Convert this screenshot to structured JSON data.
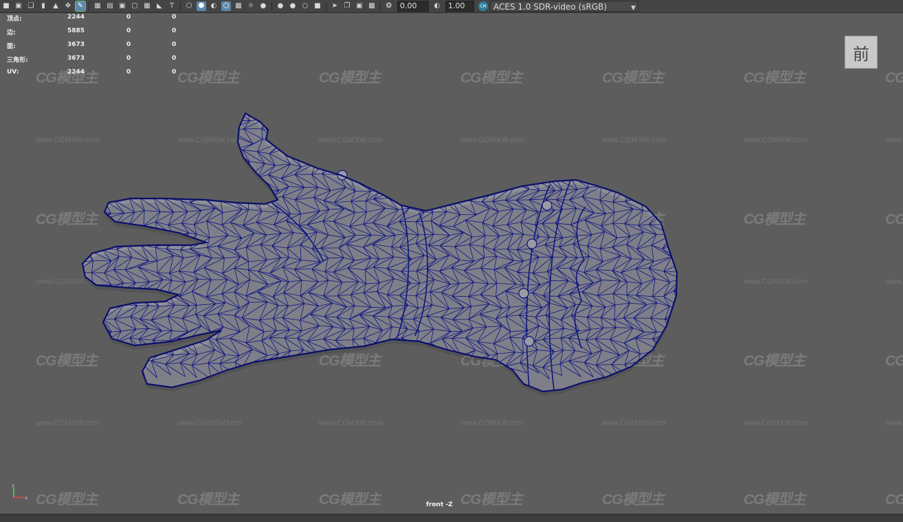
{
  "toolbar": {
    "icons": [
      "camera-icon",
      "camera-attributes-icon",
      "bookmark-icon",
      "image-plane-icon",
      "grid-icon",
      "2d-pan-icon",
      "grease-pencil-icon",
      "wireframe-icon",
      "resolution-gate-icon",
      "gate-mask-icon",
      "field-chart-icon",
      "safe-action-icon",
      "safe-title-icon",
      "shaded-icon",
      "smooth-shade-icon",
      "flat-shade-icon",
      "bounding-box-icon",
      "use-default-material-icon",
      "textured-icon",
      "lights-icon",
      "shadows-icon",
      "ambient-occlusion-icon",
      "motion-blur-icon",
      "anti-alias-icon",
      "depth-of-field-icon",
      "isolate-select-icon",
      "xray-icon",
      "xray-joints-icon",
      "xray-components-icon",
      "exposure-icon",
      "gamma-icon"
    ],
    "exposure_value": "0.00",
    "gamma_value": "1.00",
    "color_space_badge": "CM",
    "color_space": "ACES 1.0 SDR-video (sRGB)"
  },
  "hud": {
    "rows": [
      {
        "label": "顶点:",
        "v1": "2244",
        "v2": "0",
        "v3": "0"
      },
      {
        "label": "边:",
        "v1": "5885",
        "v2": "0",
        "v3": "0"
      },
      {
        "label": "面:",
        "v1": "3673",
        "v2": "0",
        "v3": "0"
      },
      {
        "label": "三角形:",
        "v1": "3673",
        "v2": "0",
        "v3": "0"
      },
      {
        "label": "UV:",
        "v1": "2244",
        "v2": "0",
        "v3": "0"
      }
    ]
  },
  "view_cube_label": "前",
  "camera_label": "front -Z",
  "axis": {
    "y": "y",
    "x": "x"
  },
  "watermark": {
    "logo": "CG模型主",
    "url": "www.CGMXW.com"
  },
  "colors": {
    "viewport_bg": "#5d5d5d",
    "mesh_fill": "#8f8f97",
    "mesh_wire": "#0d1480",
    "toolbar_bg": "#444444",
    "accent": "#5d87a8"
  }
}
